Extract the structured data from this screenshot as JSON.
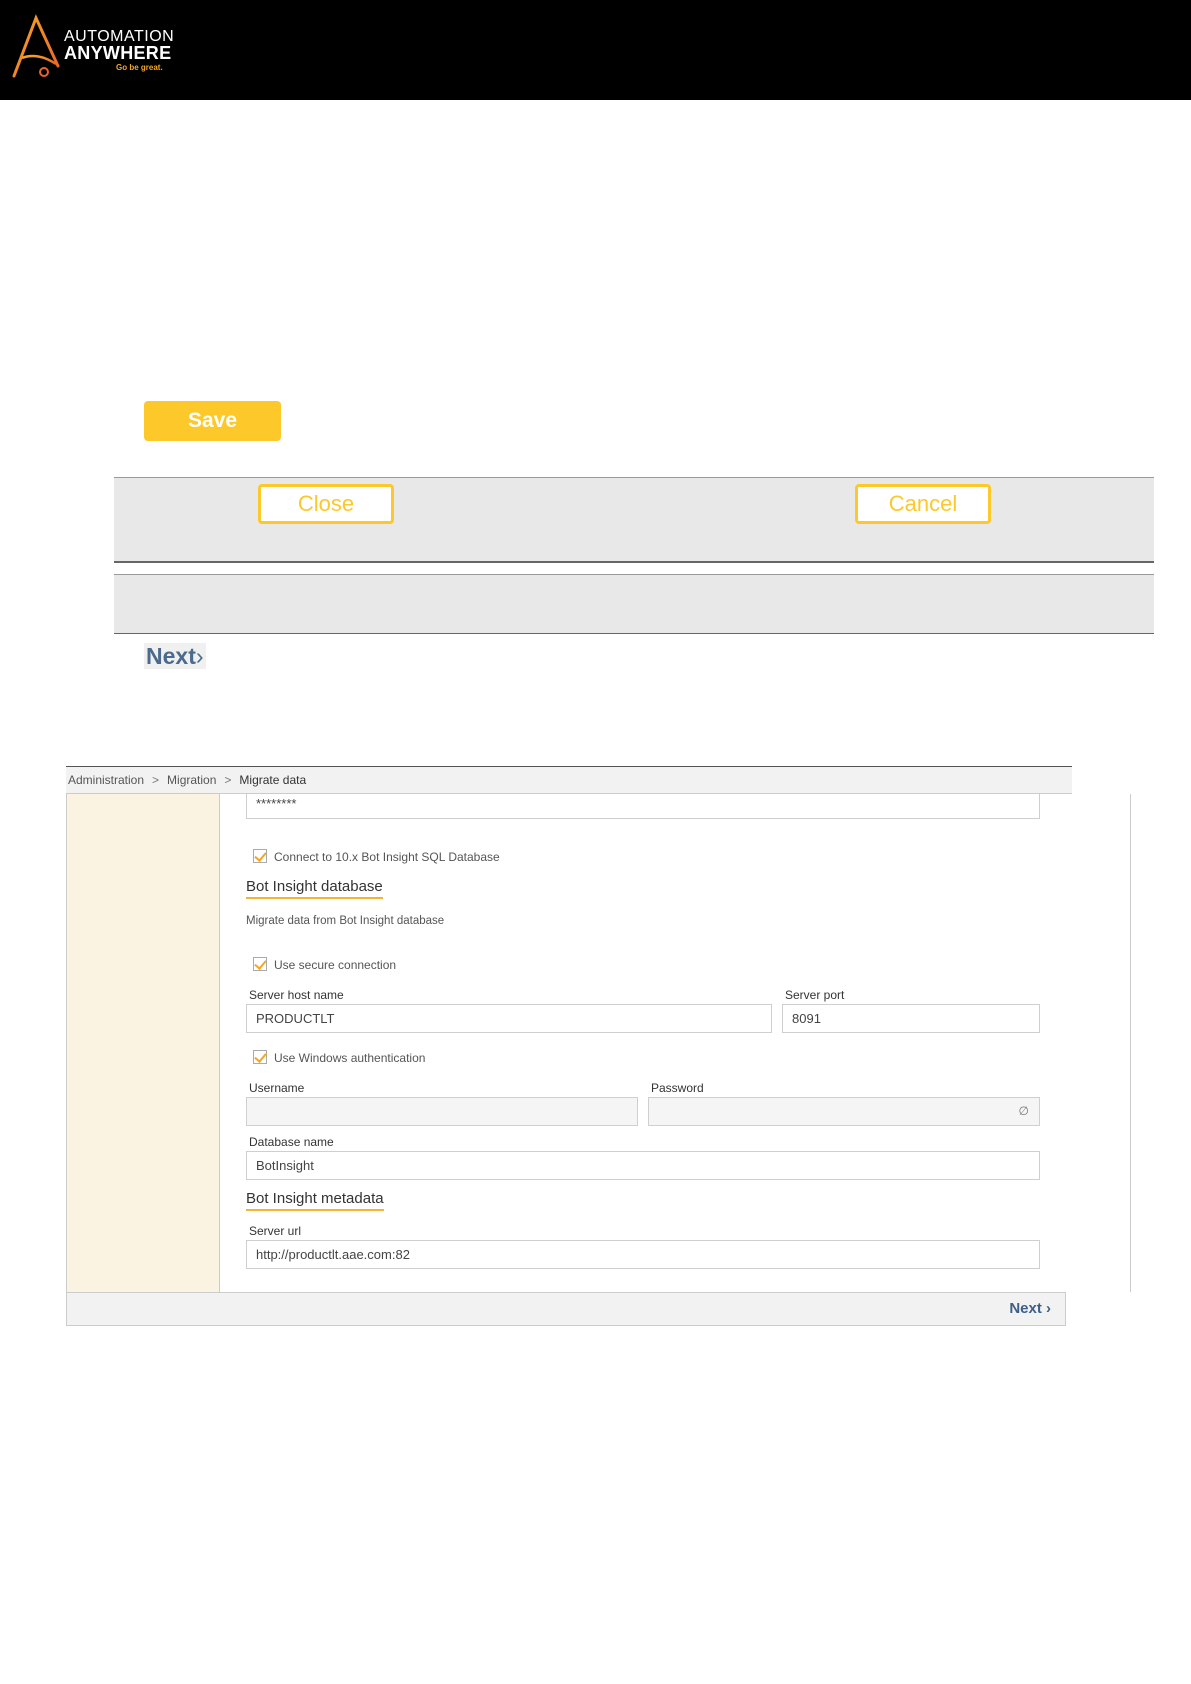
{
  "header": {
    "brand_line1": "AUTOMATION",
    "brand_line2": "ANYWHERE",
    "tagline": "Go be great.",
    "colors": {
      "background": "#000000",
      "accent": "#f7a823"
    }
  },
  "buttons": {
    "save": "Save",
    "close": "Close",
    "cancel": "Cancel",
    "next": "Next",
    "next_glyph": "›"
  },
  "screenshot": {
    "breadcrumb": [
      "Administration",
      "Migration",
      "Migrate data"
    ],
    "breadcrumb_sep": ">",
    "password_top": "********",
    "connect_checkbox": "Connect to 10.x Bot Insight SQL Database",
    "bot_insight_db": {
      "title": "Bot Insight database",
      "description": "Migrate data from Bot Insight database",
      "secure_checkbox": "Use secure connection",
      "server_host_label": "Server host name",
      "server_host_value": "PRODUCTLT",
      "server_port_label": "Server port",
      "server_port_value": "8091",
      "windows_auth_checkbox": "Use Windows authentication",
      "username_label": "Username",
      "password_label": "Password",
      "database_name_label": "Database name",
      "database_name_value": "BotInsight"
    },
    "bot_insight_meta": {
      "title": "Bot Insight metadata",
      "server_url_label": "Server url",
      "server_url_value": "http://productlt.aae.com:82"
    },
    "footer_next": "Next",
    "colors": {
      "sidebar": "#faf3e1",
      "accent": "#f5b335",
      "link": "#3e5f87"
    }
  }
}
